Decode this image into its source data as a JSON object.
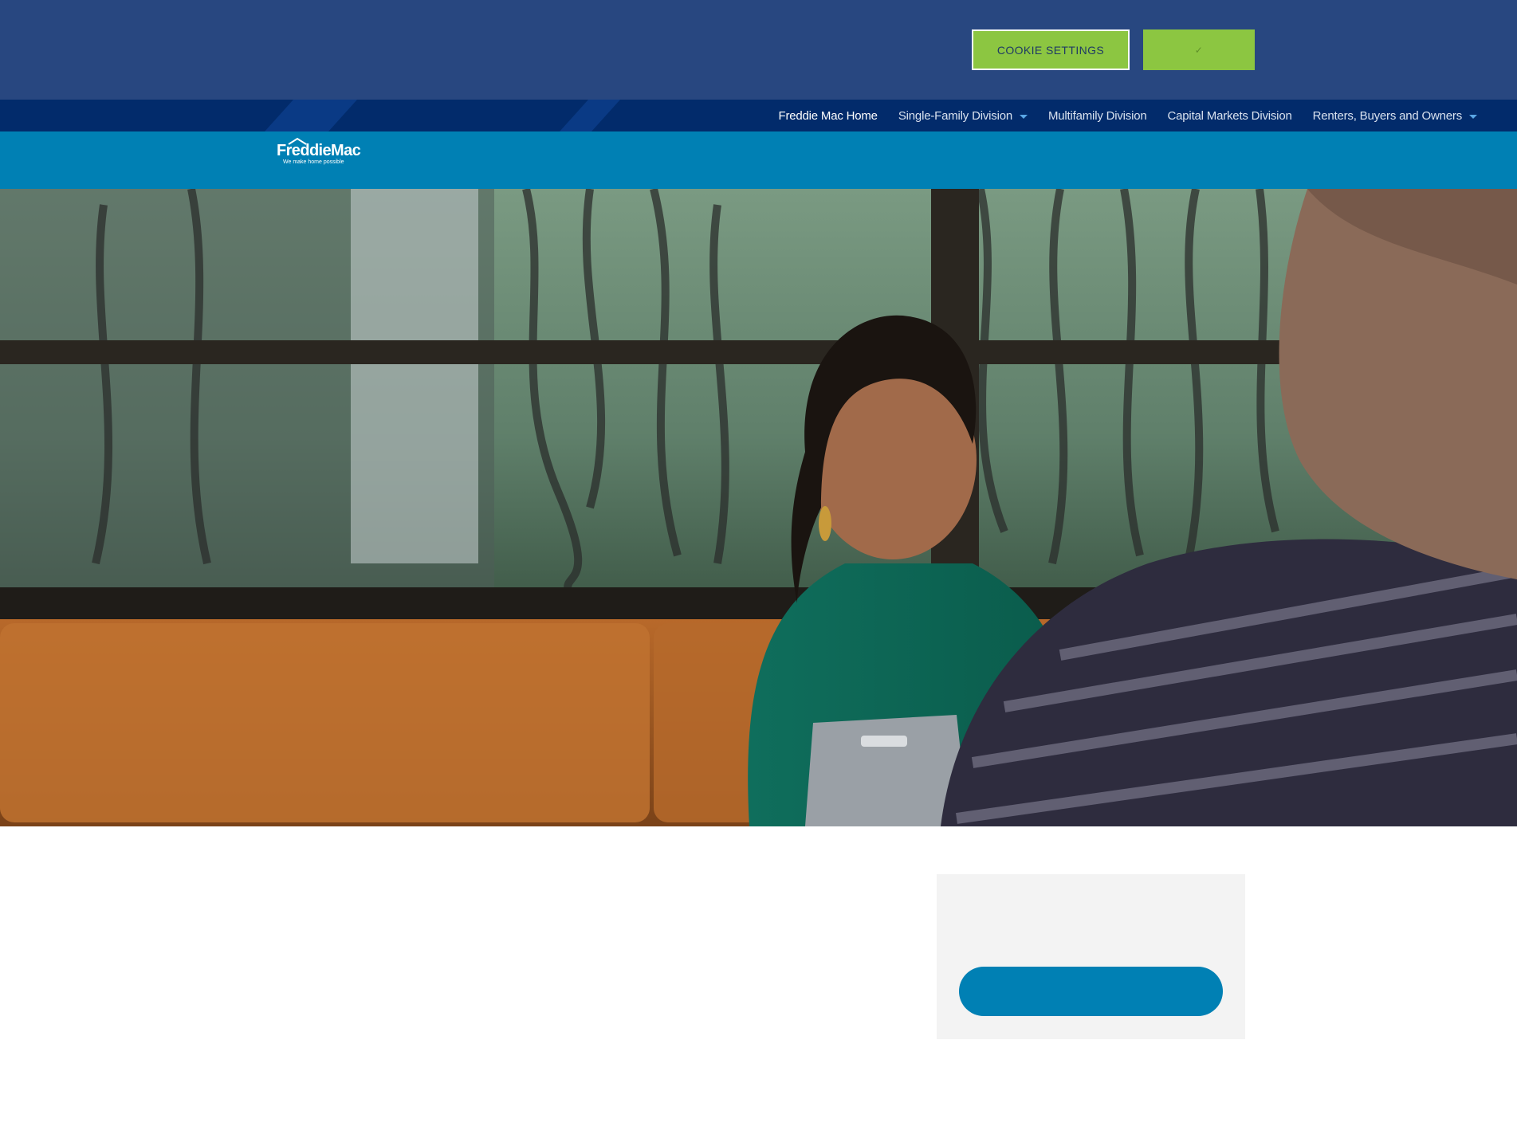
{
  "cookie_banner": {
    "settings_label": "COOKIE SETTINGS",
    "accept_label": "✓"
  },
  "top_nav": {
    "items": [
      {
        "label": "Freddie Mac Home",
        "active": true
      },
      {
        "label": "Single-Family Division",
        "dropdown": true
      },
      {
        "label": "Multifamily Division"
      },
      {
        "label": "Capital Markets Division"
      },
      {
        "label": "Renters, Buyers and Owners",
        "dropdown": true
      }
    ]
  },
  "brand": {
    "logo_text": "FreddieMac",
    "tagline": "We make home possible"
  },
  "colors": {
    "cookie_banner": "#284780",
    "top_nav": "#022b6b",
    "brand_bar": "#0080b4",
    "accent_green": "#8cc641",
    "cta_blue": "#0080b4"
  }
}
